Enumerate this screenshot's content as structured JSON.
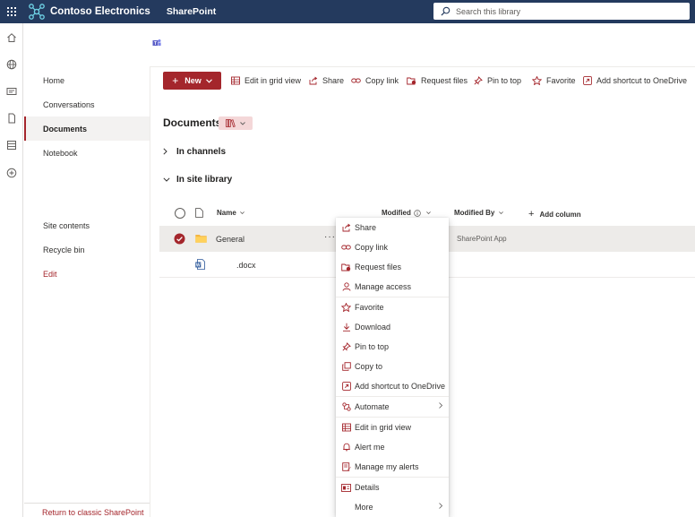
{
  "suite": {
    "brand": "Contoso Electronics",
    "app": "SharePoint",
    "search_placeholder": "Search this library"
  },
  "rail": {
    "icons": [
      "home-icon",
      "globe-icon",
      "news-icon",
      "file-icon",
      "list-icon",
      "add-icon"
    ]
  },
  "nav": {
    "items": [
      "Home",
      "Conversations",
      "Documents",
      "Notebook"
    ],
    "active": "Documents",
    "site_contents": "Site contents",
    "recycle_bin": "Recycle bin",
    "edit": "Edit",
    "return_classic": "Return to classic SharePoint"
  },
  "commands": {
    "new": "New",
    "edit_grid": "Edit in grid view",
    "share": "Share",
    "copy_link": "Copy link",
    "request_files": "Request files",
    "pin_top": "Pin to top",
    "favorite": "Favorite",
    "add_shortcut": "Add shortcut to OneDrive"
  },
  "library": {
    "title": "Documents",
    "groups": [
      "In channels",
      "In site library"
    ]
  },
  "columns": {
    "name": "Name",
    "modified": "Modified",
    "modified_by": "Modified By",
    "add_column": "Add column"
  },
  "rows": [
    {
      "name": "General",
      "modified_by": "SharePoint App",
      "more": "···"
    },
    {
      "name": ".docx"
    }
  ],
  "context_menu": {
    "items": [
      {
        "label": "Share",
        "icon": "share-icon"
      },
      {
        "label": "Copy link",
        "icon": "link-icon"
      },
      {
        "label": "Request files",
        "icon": "request-files-icon"
      },
      {
        "label": "Manage access",
        "icon": "person-icon"
      },
      {
        "label": "Favorite",
        "icon": "star-icon"
      },
      {
        "label": "Download",
        "icon": "download-icon"
      },
      {
        "label": "Pin to top",
        "icon": "pin-icon"
      },
      {
        "label": "Copy to",
        "icon": "copy-icon"
      },
      {
        "label": "Add shortcut to OneDrive",
        "icon": "shortcut-icon"
      },
      {
        "label": "Automate",
        "icon": "automate-icon"
      },
      {
        "label": "Edit in grid view",
        "icon": "grid-icon"
      },
      {
        "label": "Alert me",
        "icon": "bell-icon"
      },
      {
        "label": "Manage my alerts",
        "icon": "alerts-icon"
      },
      {
        "label": "Details",
        "icon": "details-icon"
      },
      {
        "label": "More",
        "icon": ""
      }
    ]
  },
  "colors": {
    "suite_bar": "#243a5e",
    "accent": "#a4262c",
    "selected_row": "#edebe9"
  }
}
